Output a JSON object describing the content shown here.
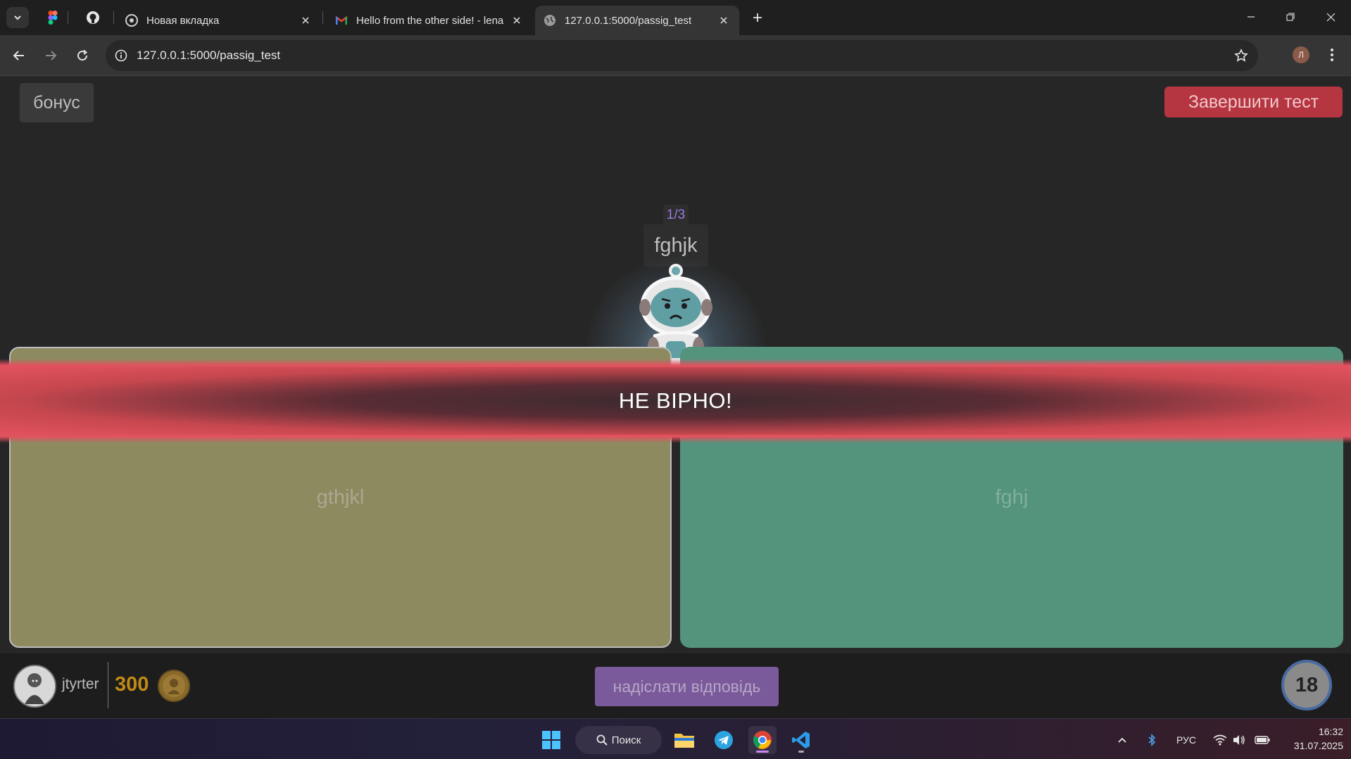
{
  "browser": {
    "tabs": [
      {
        "title": "Новая вкладка",
        "icon": "chrome-icon"
      },
      {
        "title": "Hello from the other side! - lena",
        "icon": "gmail-icon"
      },
      {
        "title": "127.0.0.1:5000/passig_test",
        "icon": "globe-icon",
        "active": true
      }
    ],
    "url": "127.0.0.1:5000/passig_test",
    "profile_initial": "Л"
  },
  "page": {
    "bonus_label": "бонус",
    "finish_label": "Завершити тест",
    "question_counter": "1/3",
    "question_text": "fghjk",
    "answers": [
      {
        "text": "gthjkl",
        "color": "#8d8a60"
      },
      {
        "text": "fghj",
        "color": "#54937c"
      }
    ],
    "result_banner": "НЕ ВІРНО!",
    "user": {
      "name": "jtyrter",
      "coins": "300"
    },
    "submit_label": "надіслати відповідь",
    "timer": "18"
  },
  "taskbar": {
    "search_label": "Поиск",
    "language": "РУС",
    "time": "16:32",
    "date": "31.07.2025"
  },
  "colors": {
    "finish_button": "#b53540",
    "banner": "#e2525f",
    "submit_button": "#7a5a9a",
    "coins": "#c08a15"
  }
}
